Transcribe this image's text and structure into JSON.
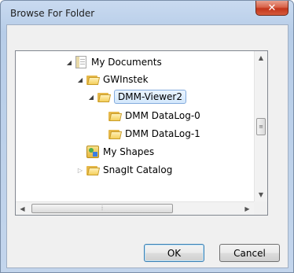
{
  "window": {
    "title": "Browse For Folder"
  },
  "tree": {
    "items": [
      {
        "label": "My Documents",
        "icon": "documents-icon",
        "expanded": true
      },
      {
        "label": "GWInstek",
        "icon": "folder-icon",
        "expanded": true
      },
      {
        "label": "DMM-Viewer2",
        "icon": "folder-icon",
        "expanded": true,
        "selected": true
      },
      {
        "label": "DMM DataLog-0",
        "icon": "folder-icon"
      },
      {
        "label": "DMM DataLog-1",
        "icon": "folder-icon"
      },
      {
        "label": "My Shapes",
        "icon": "shapes-folder-icon"
      },
      {
        "label": "SnagIt Catalog",
        "icon": "folder-icon",
        "expanded": false
      }
    ]
  },
  "buttons": {
    "ok": "OK",
    "cancel": "Cancel"
  },
  "colors": {
    "selection": "#d3e7fc",
    "close": "#c2351c"
  }
}
